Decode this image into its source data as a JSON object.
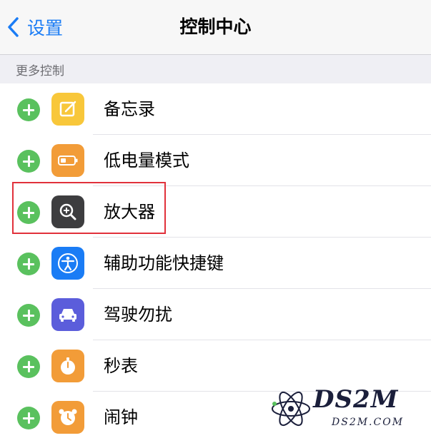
{
  "nav": {
    "back_label": "设置",
    "title": "控制中心",
    "accent_color": "#1a7cf5"
  },
  "section": {
    "header": "更多控制"
  },
  "items": [
    {
      "label": "备忘录",
      "icon": "notes-icon",
      "color": "#f8c73a"
    },
    {
      "label": "低电量模式",
      "icon": "battery-icon",
      "color": "#f29c38"
    },
    {
      "label": "放大器",
      "icon": "magnifier-icon",
      "color": "#3d3d3f",
      "highlighted": true
    },
    {
      "label": "辅助功能快捷键",
      "icon": "accessibility-icon",
      "color": "#1a7cf5"
    },
    {
      "label": "驾驶勿扰",
      "icon": "car-icon",
      "color": "#5b5ddb"
    },
    {
      "label": "秒表",
      "icon": "stopwatch-icon",
      "color": "#f29c38"
    },
    {
      "label": "闹钟",
      "icon": "alarm-icon",
      "color": "#f29c38"
    }
  ],
  "watermark": {
    "title": "DS2M",
    "subtitle": "DS2M.COM"
  },
  "colors": {
    "add_button": "#5ac15e",
    "highlight_box": "#e1313b"
  }
}
